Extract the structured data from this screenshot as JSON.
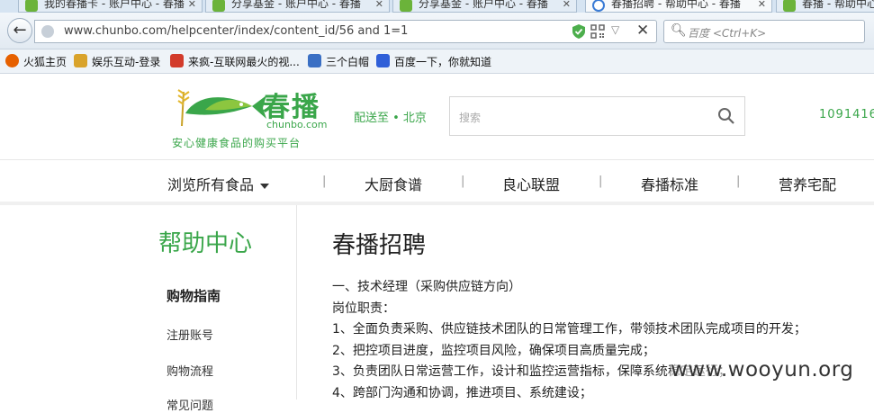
{
  "browser": {
    "tabs": [
      {
        "label": "我的春播卡 - 账户中心 - 春播"
      },
      {
        "label": "分享基金 - 账户中心 - 春播"
      },
      {
        "label": "分享基金 - 账户中心 - 春播"
      },
      {
        "label": "春播招聘 - 帮助中心 - 春播"
      },
      {
        "label": "春播 - 帮助中心 - 春播"
      }
    ],
    "url": "www.chunbo.com/helpcenter/index/content_id/56 and 1=1",
    "search_placeholder": "百度 <Ctrl+K>",
    "bookmarks": [
      {
        "label": "火狐主页",
        "color": "#e66000"
      },
      {
        "label": "娱乐互动-登录",
        "color": "#d9a32b"
      },
      {
        "label": "来疯-互联网最火的视...",
        "color": "#d23b2b"
      },
      {
        "label": "三个白帽",
        "color": "#3a6fc4"
      },
      {
        "label": "百度一下，你就知道",
        "color": "#2f5fd8"
      }
    ]
  },
  "site": {
    "logo_cn": "春播",
    "logo_en": "chunbo.com",
    "slogan": "安心健康食品的购买平台",
    "deliver": "配送至 • 北京",
    "search_placeholder": "搜索",
    "phone": "1091416",
    "brand_color": "#3aa64a",
    "nav": [
      {
        "label": "浏览所有食品"
      },
      {
        "label": "大厨食谱"
      },
      {
        "label": "良心联盟"
      },
      {
        "label": "春播标准"
      },
      {
        "label": "营养宅配"
      }
    ],
    "nav_separator": "|"
  },
  "sidebar": {
    "title": "帮助中心",
    "section": "购物指南",
    "links": [
      {
        "label": "注册账号"
      },
      {
        "label": "购物流程"
      },
      {
        "label": "常见问题"
      }
    ]
  },
  "content": {
    "title": "春播招聘",
    "lines": [
      "一、技术经理（采购供应链方向）",
      "岗位职责：",
      "1、全面负责采购、供应链技术团队的日常管理工作，带领技术团队完成项目的开发；",
      "2、把控项目进度，监控项目风险，确保项目高质量完成；",
      "3、负责团队日常运营工作，设计和监控运营指标，保障系统稳定运行；",
      "4、跨部门沟通和协调，推进项目、系统建设；"
    ]
  },
  "watermark": "www.wooyun.org"
}
